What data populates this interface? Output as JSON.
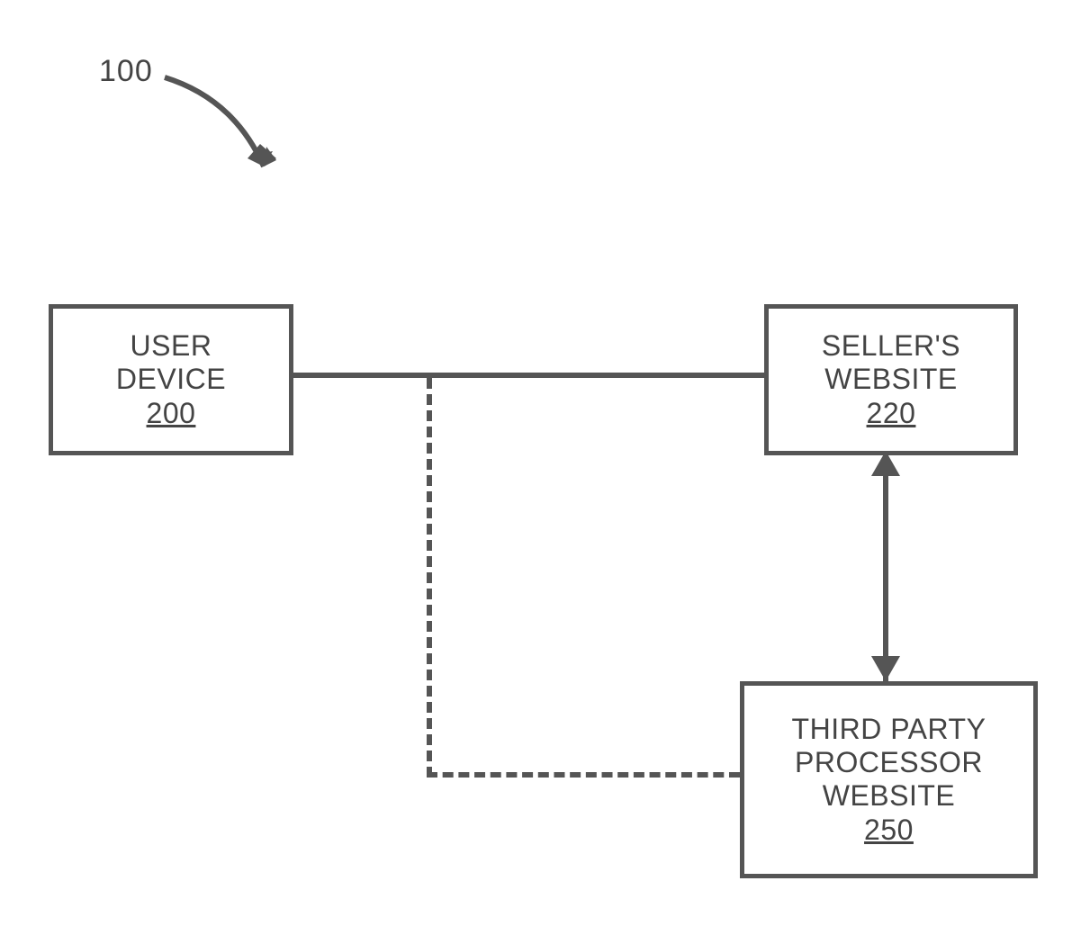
{
  "figure_number": "100",
  "boxes": {
    "user_device": {
      "line1": "USER",
      "line2": "DEVICE",
      "ref": "200"
    },
    "seller_website": {
      "line1": "SELLER'S",
      "line2": "WEBSITE",
      "ref": "220"
    },
    "third_party": {
      "line1": "THIRD PARTY",
      "line2": "PROCESSOR",
      "line3": "WEBSITE",
      "ref": "250"
    }
  },
  "connections": {
    "user_to_seller": {
      "type": "solid",
      "style": "line"
    },
    "midpoint_to_third_party": {
      "type": "dashed",
      "style": "L-shape"
    },
    "seller_to_third_party": {
      "type": "solid",
      "style": "double-arrow"
    }
  }
}
